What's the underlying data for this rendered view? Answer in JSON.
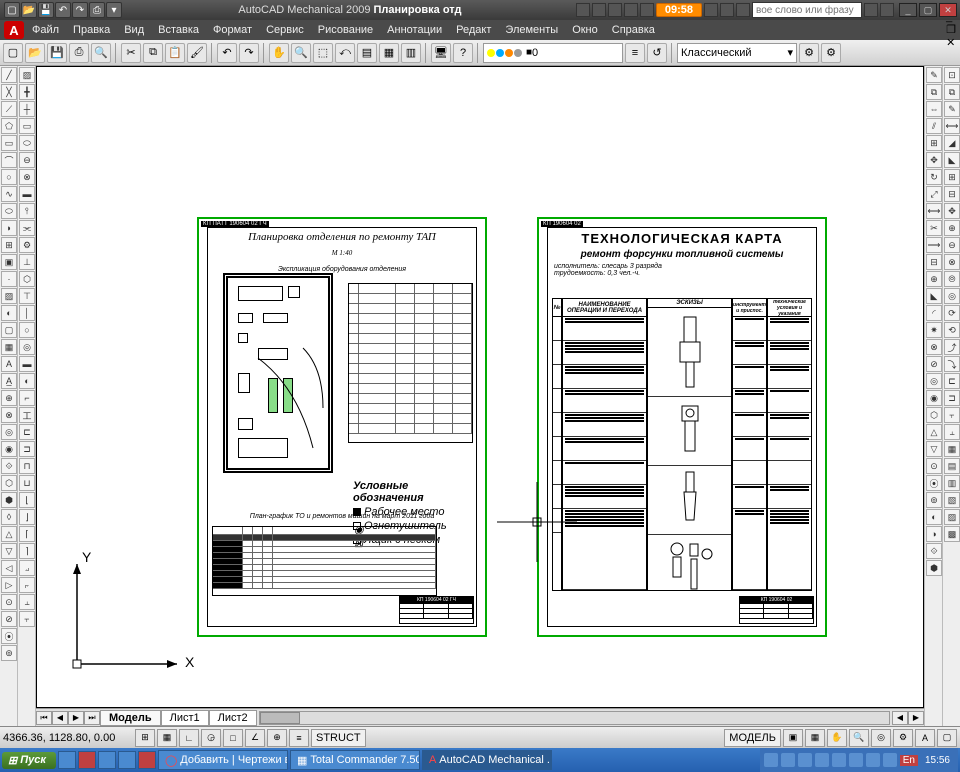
{
  "titlebar": {
    "app": "AutoCAD Mechanical 2009",
    "doc": "Планировка отд",
    "time_badge": "09:58",
    "search_placeholder": "вое слово или фразу"
  },
  "menu": [
    "Файл",
    "Правка",
    "Вид",
    "Вставка",
    "Формат",
    "Сервис",
    "Рисование",
    "Аннотации",
    "Редакт",
    "Элементы",
    "Окно",
    "Справка"
  ],
  "toolbar": {
    "layer_name": "0",
    "style_name": "Классический"
  },
  "tabs": {
    "model": "Модель",
    "sheet1": "Лист1",
    "sheet2": "Лист2"
  },
  "status": {
    "coords": "4366.36, 1128.80, 0.00",
    "struct": "STRUCT",
    "model": "МОДЕЛЬ"
  },
  "taskbar": {
    "start": "Пуск",
    "tasks": [
      "Добавить | Чертежи в ...",
      "Total Commander 7.50a ...",
      "AutoCAD Mechanical ..."
    ],
    "clock": "15:56",
    "lang": "En"
  },
  "sheet1": {
    "code": "КП ПАТТ 190604 02 ГЧ",
    "title": "Планировка отделения по ремонту ТАП",
    "scale": "М 1:40",
    "subtitle": "Экспликация оборудования отделения",
    "legend_title": "Условные обозначения",
    "legend_items": [
      "Рабочее место",
      "Огнетушитель",
      "Ящик с песком"
    ],
    "schedule_title": "План-график ТО и ремонтов машин на март 2011 года",
    "titleblock_code": "КП 190604 02 ГЧ"
  },
  "sheet2": {
    "code": "КП 190604 02",
    "title": "ТЕХНОЛОГИЧЕСКАЯ КАРТА",
    "subtitle": "ремонт форсунки топливной системы",
    "performer": "исполнитель: слесарь 3 разряда",
    "labor": "трудоемкость: 0,3 чел.-ч.",
    "col_num": "№",
    "col_ops": "НАИМЕНОВАНИЕ ОПЕРАЦИИ И ПЕРЕХОДА",
    "col_sketch": "ЭСКИЗЫ",
    "col_tool": "инструмент и приспос.",
    "col_req": "технические условия и указания",
    "titleblock_code": "КП 190604 02"
  },
  "ucs": {
    "x": "X",
    "y": "Y"
  }
}
